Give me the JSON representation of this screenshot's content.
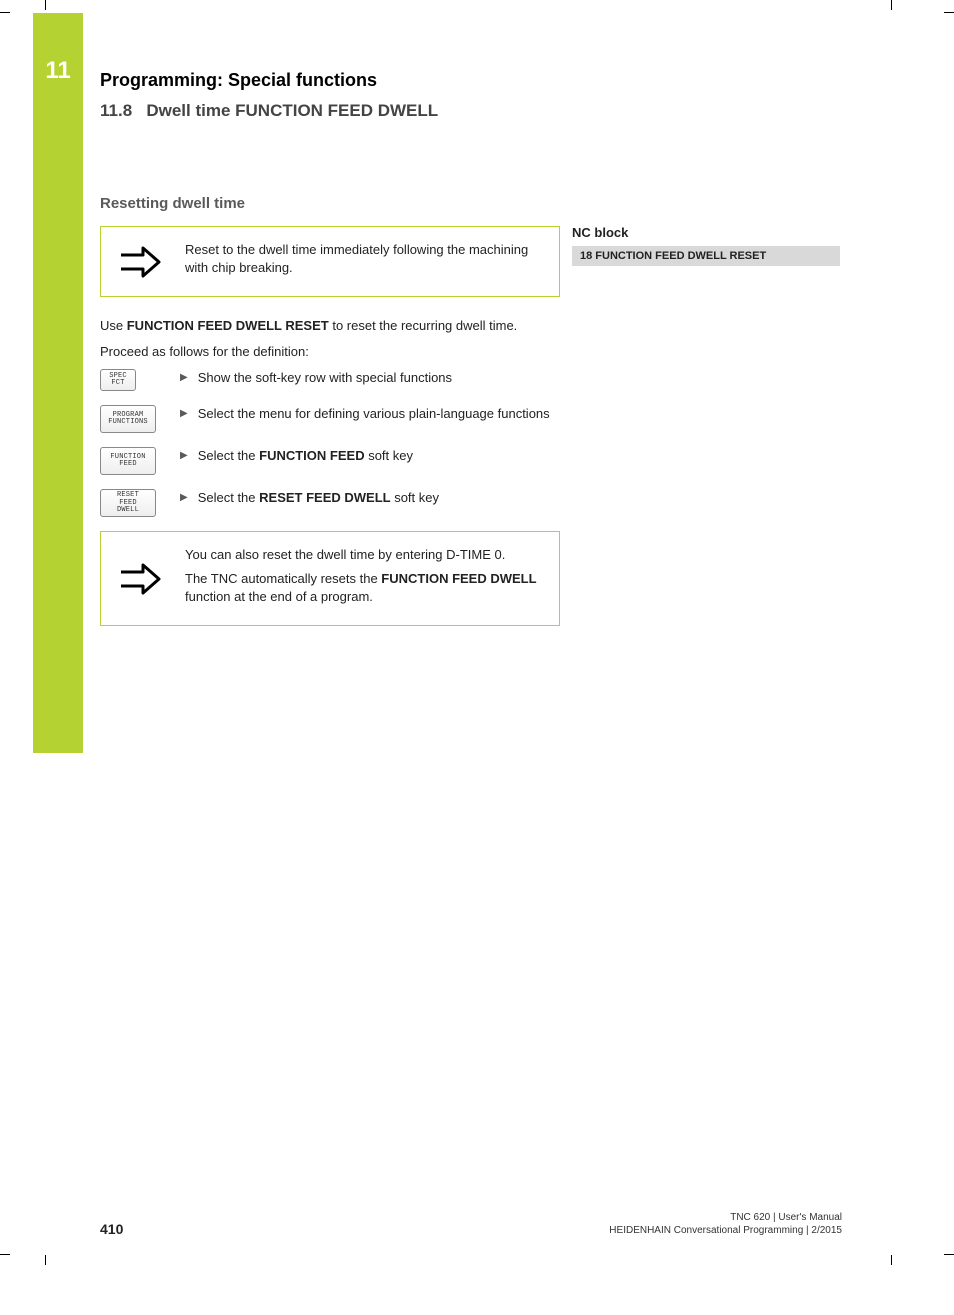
{
  "chapter": {
    "number": "11",
    "title": "Programming: Special functions",
    "section_num": "11.8",
    "section_title": "Dwell time FUNCTION FEED DWELL"
  },
  "subheading": "Resetting dwell time",
  "note1": "Reset to the dwell time immediately following the machining with chip breaking.",
  "intro_prefix": "Use ",
  "intro_bold": "FUNCTION FEED DWELL RESET",
  "intro_suffix": " to reset the recurring dwell time.",
  "proceed": "Proceed as follows for the definition:",
  "steps": [
    {
      "key_lines": [
        "SPEC",
        "FCT"
      ],
      "key_class": "key-spec",
      "text_pre": "Show the soft-key row with special functions",
      "bold": "",
      "text_post": ""
    },
    {
      "key_lines": [
        "PROGRAM",
        "FUNCTIONS"
      ],
      "key_class": "key-wide",
      "text_pre": "Select the menu for defining various plain-language functions",
      "bold": "",
      "text_post": ""
    },
    {
      "key_lines": [
        "FUNCTION",
        "FEED"
      ],
      "key_class": "key-wide",
      "text_pre": "Select the ",
      "bold": "FUNCTION FEED",
      "text_post": " soft key"
    },
    {
      "key_lines": [
        "RESET",
        "FEED",
        "DWELL"
      ],
      "key_class": "key-wide",
      "text_pre": "Select the ",
      "bold": "RESET FEED DWELL",
      "text_post": " soft key"
    }
  ],
  "note2_p1": "You can also reset the dwell time by entering D-TIME 0.",
  "note2_p2_pre": "The TNC automatically resets the ",
  "note2_p2_bold": "FUNCTION FEED DWELL",
  "note2_p2_post": " function at the end of a program.",
  "sidebar": {
    "head": "NC block",
    "row": "18 FUNCTION FEED DWELL RESET"
  },
  "footer": {
    "page": "410",
    "line1": "TNC 620 | User's Manual",
    "line2": "HEIDENHAIN Conversational Programming | 2/2015"
  }
}
